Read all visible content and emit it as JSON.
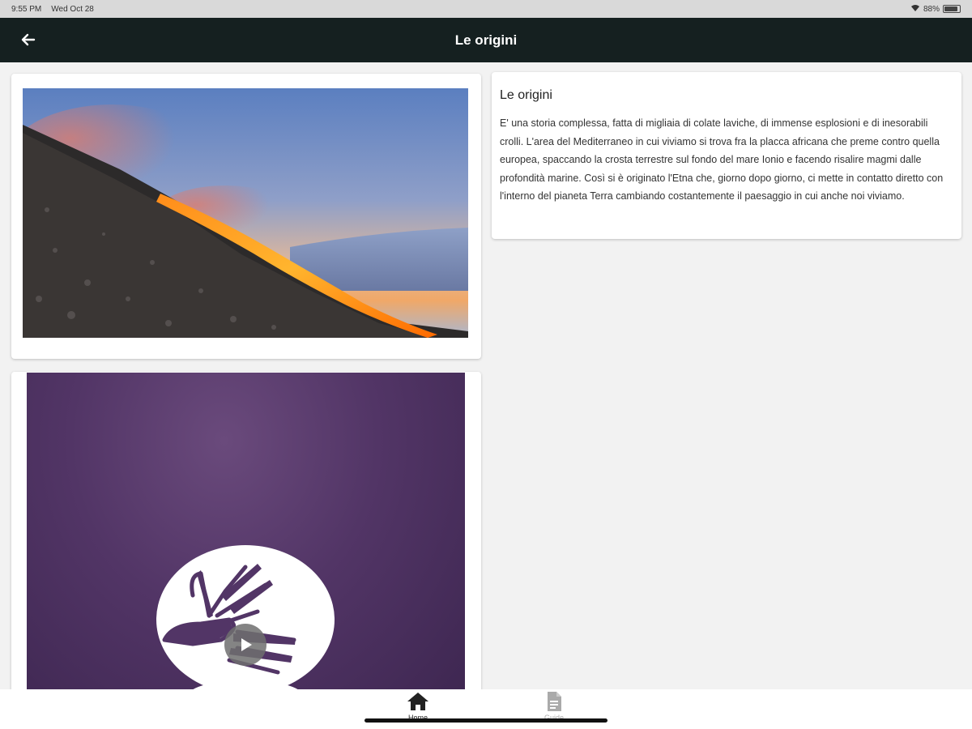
{
  "status_bar": {
    "time": "9:55 PM",
    "date": "Wed Oct 28",
    "battery": "88%",
    "battery_level": 0.88
  },
  "app_bar": {
    "title": "Le origini",
    "back_icon": "arrow-left-icon"
  },
  "image_card": {
    "image": "etna-lava-flow-photo"
  },
  "text_card": {
    "title": "Le origini",
    "body": "E' una storia complessa, fatta di migliaia di colate laviche, di immense esplosioni e di inesorabili crolli. L'area del Mediterraneo in cui viviamo si trova fra la placca africana che preme contro quella europea, spaccando la crosta terrestre sul fondo del mare Ionio e facendo risalire magmi dalle profondità marine. Così si è originato l'Etna che, giorno dopo giorno, ci mette in contatto diretto con l'interno del pianeta Terra cambiando costantemente il paesaggio in cui anche noi viviamo."
  },
  "video_card": {
    "play_icon": "play-icon",
    "logo": "sign-language-hands-logo"
  },
  "bottom_nav": {
    "items": [
      {
        "label": "Home",
        "icon": "home-icon",
        "active": true
      },
      {
        "label": "Guide",
        "icon": "document-icon",
        "active": false
      }
    ]
  },
  "colors": {
    "app_bar": "#152020",
    "video_bg": "#523566",
    "active_nav": "#222222",
    "inactive_nav": "#aaaaaa"
  }
}
